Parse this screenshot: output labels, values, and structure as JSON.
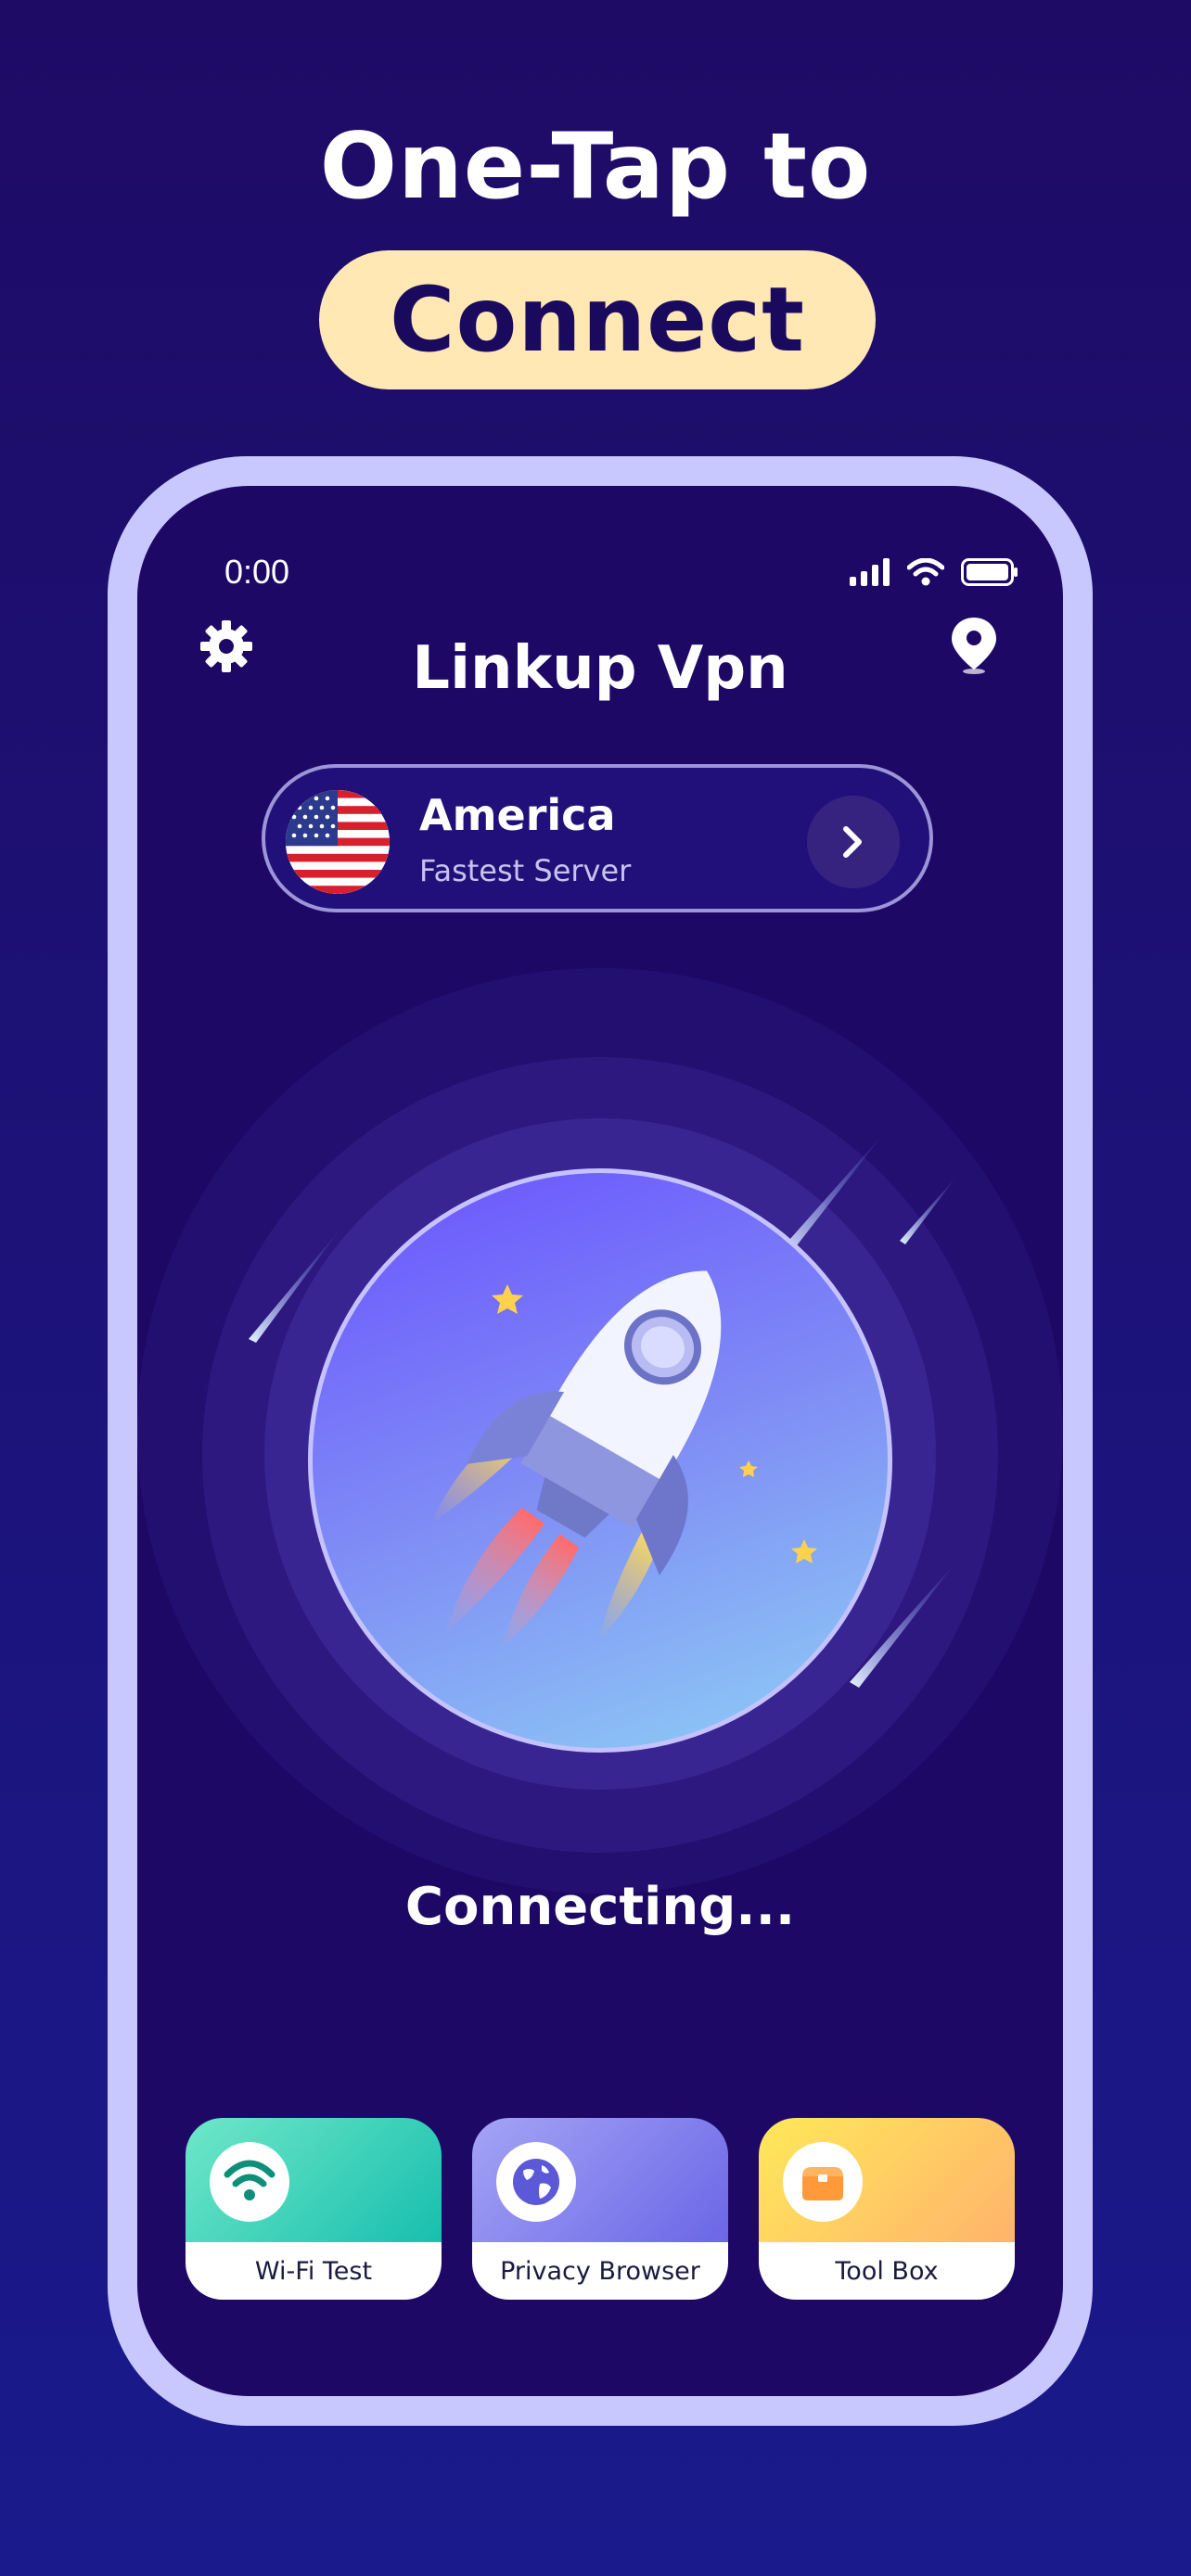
{
  "headline": {
    "line1": "One-Tap to",
    "line2": "Connect"
  },
  "status_bar": {
    "time": "0:00"
  },
  "app": {
    "title": "Linkup Vpn"
  },
  "server": {
    "country": "America",
    "subtitle": "Fastest Server"
  },
  "connection": {
    "status": "Connecting..."
  },
  "tiles": [
    {
      "label": "Wi-Fi Test",
      "icon": "wifi-icon",
      "gradient": [
        "#6fe7c8",
        "#17bfae"
      ],
      "icon_color": "#0d8f7a"
    },
    {
      "label": "Privacy Browser",
      "icon": "globe-icon",
      "gradient": [
        "#a4a4f5",
        "#6a66e6"
      ],
      "icon_color": "#5c59d8"
    },
    {
      "label": "Tool Box",
      "icon": "toolbox-icon",
      "gradient": [
        "#ffe85a",
        "#ffb36b"
      ],
      "icon_color": "#ff9a3a"
    }
  ],
  "colors": {
    "background_top": "#1e0b66",
    "background_bottom": "#1a1a8c",
    "phone_frame": "#c8c8ff",
    "screen": "#1d0866",
    "headline_pill": "#ffe8b3"
  }
}
